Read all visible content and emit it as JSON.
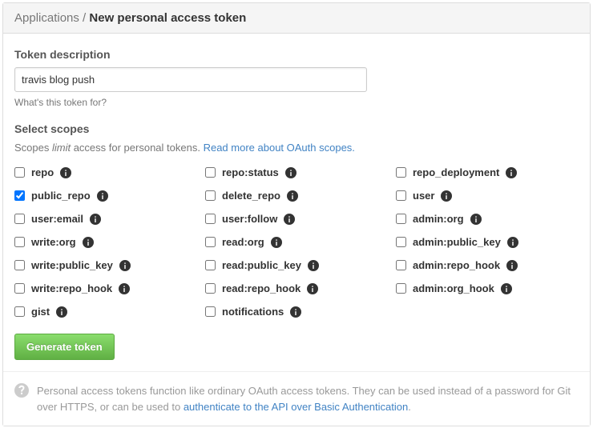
{
  "header": {
    "breadcrumb": "Applications /",
    "title": "New personal access token"
  },
  "form": {
    "description_label": "Token description",
    "description_value": "travis blog push",
    "description_help": "What's this token for?",
    "scopes_label": "Select scopes",
    "scopes_desc_prefix": "Scopes ",
    "scopes_desc_em": "limit",
    "scopes_desc_suffix": " access for personal tokens. ",
    "scopes_link": "Read more about OAuth scopes.",
    "submit_label": "Generate token"
  },
  "scopes": [
    {
      "label": "repo",
      "checked": false,
      "info": true
    },
    {
      "label": "repo:status",
      "checked": false,
      "info": true
    },
    {
      "label": "repo_deployment",
      "checked": false,
      "info": true
    },
    {
      "label": "public_repo",
      "checked": true,
      "info": true
    },
    {
      "label": "delete_repo",
      "checked": false,
      "info": true
    },
    {
      "label": "user",
      "checked": false,
      "info": true
    },
    {
      "label": "user:email",
      "checked": false,
      "info": true
    },
    {
      "label": "user:follow",
      "checked": false,
      "info": true
    },
    {
      "label": "admin:org",
      "checked": false,
      "info": true
    },
    {
      "label": "write:org",
      "checked": false,
      "info": true
    },
    {
      "label": "read:org",
      "checked": false,
      "info": true
    },
    {
      "label": "admin:public_key",
      "checked": false,
      "info": true
    },
    {
      "label": "write:public_key",
      "checked": false,
      "info": true
    },
    {
      "label": "read:public_key",
      "checked": false,
      "info": true
    },
    {
      "label": "admin:repo_hook",
      "checked": false,
      "info": true
    },
    {
      "label": "write:repo_hook",
      "checked": false,
      "info": true
    },
    {
      "label": "read:repo_hook",
      "checked": false,
      "info": true
    },
    {
      "label": "admin:org_hook",
      "checked": false,
      "info": true
    },
    {
      "label": "gist",
      "checked": false,
      "info": true
    },
    {
      "label": "notifications",
      "checked": false,
      "info": true
    }
  ],
  "footer": {
    "text_prefix": "Personal access tokens function like ordinary OAuth access tokens. They can be used instead of a password for Git over HTTPS, or can be used to ",
    "link": "authenticate to the API over Basic Authentication",
    "text_suffix": "."
  }
}
